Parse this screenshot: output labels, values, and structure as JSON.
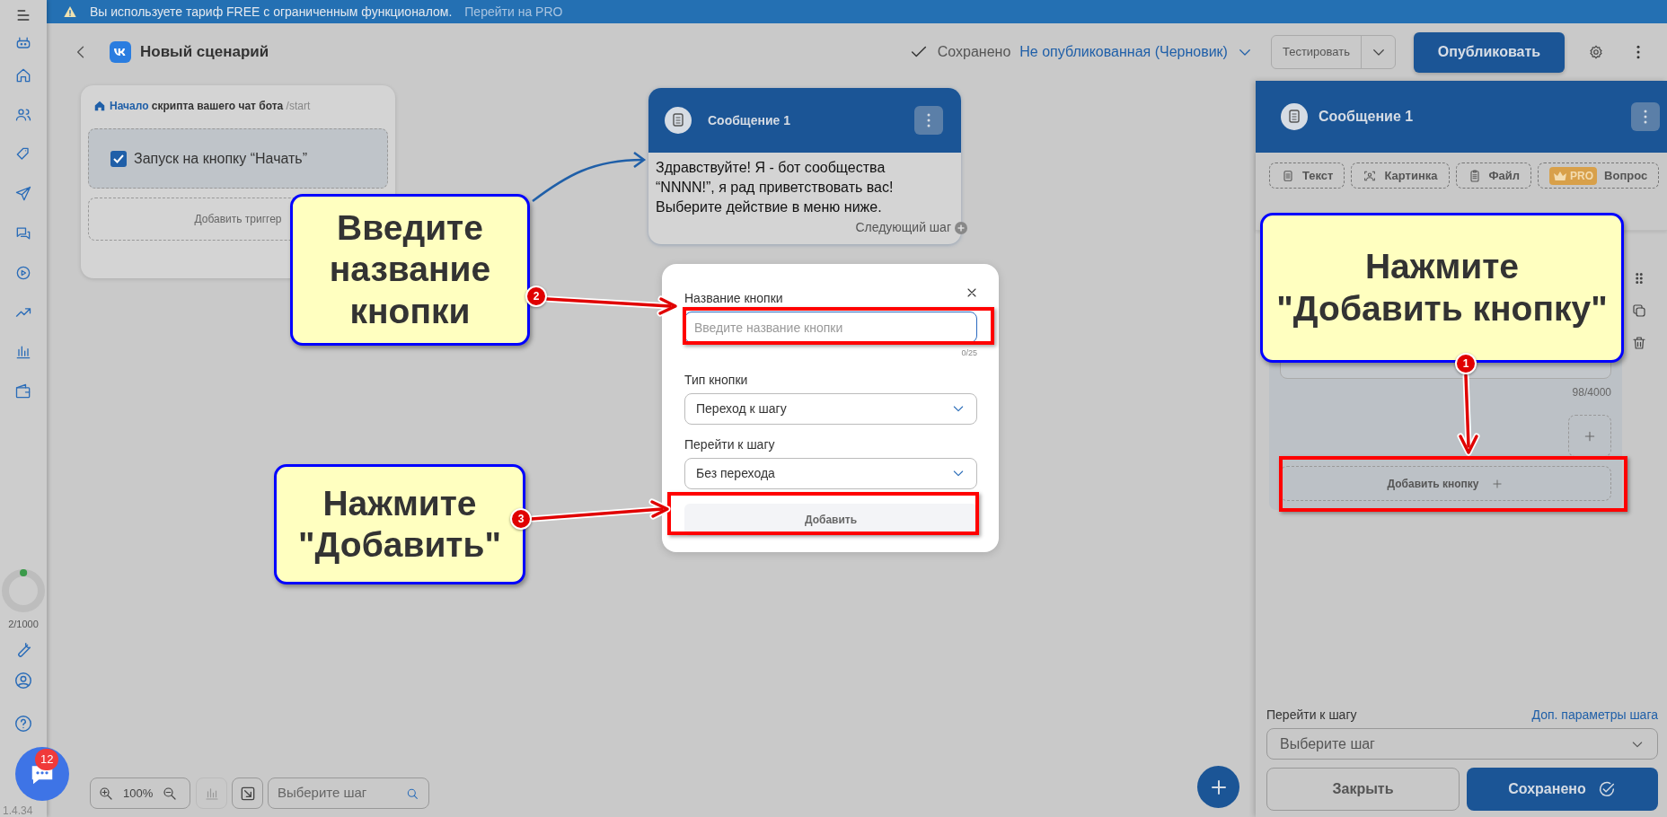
{
  "banner": {
    "text": "Вы используете тариф FREE с ограниченным функционалом.",
    "link": "Перейти на PRO"
  },
  "sidebar": {
    "usage": {
      "text": "2/1000"
    },
    "chat_badge": "12",
    "version": "1.4.34"
  },
  "header": {
    "title": "Новый сценарий",
    "save_status": "Сохранено",
    "publish_state": "Не опубликованная (Черновик)",
    "test_button": "Тестировать",
    "publish_button": "Опубликовать"
  },
  "start_node": {
    "link": "Начало",
    "text": "скрипта вашего чат бота",
    "command": "/start",
    "triggers": [
      {
        "label": "Запуск на кнопку “Начать”",
        "checked": true
      }
    ],
    "add_trigger": "Добавить триггер"
  },
  "message_node": {
    "title": "Сообщение 1",
    "text": "Здравствуйте! Я - бот сообщества “NNNN!”, я рад приветствовать вас! Выберите действие в меню ниже.",
    "next_step": "Следующий шаг"
  },
  "modal": {
    "fields": [
      {
        "kind": "input",
        "label": "Название кнопки",
        "placeholder": "Введите название кнопки",
        "counter": "0/25",
        "focused": true
      },
      {
        "kind": "select",
        "label": "Тип кнопки",
        "value": "Переход к шагу"
      },
      {
        "kind": "select",
        "label": "Перейти к шагу",
        "value": "Без перехода"
      }
    ],
    "submit": "Добавить"
  },
  "canvas_toolbar": {
    "zoom": "100%",
    "search_placeholder": "Выберите шаг"
  },
  "panel": {
    "title": "Сообщение 1",
    "tools": [
      {
        "kind": "text",
        "label": "Текст"
      },
      {
        "kind": "image",
        "label": "Картинка"
      },
      {
        "kind": "file",
        "label": "Файл"
      },
      {
        "kind": "question",
        "label": "Вопрос",
        "badge": "PRO"
      }
    ],
    "char_count": "98/4000",
    "add_button": "Добавить кнопку",
    "next_step_label": "Перейти к шагу",
    "params_link": "Доп. параметры шага",
    "step_placeholder": "Выберите шаг",
    "close_button": "Закрыть",
    "save_button": "Сохранено"
  },
  "annotations": [
    {
      "number": "2",
      "text": "Введите название кнопки"
    },
    {
      "number": "1",
      "text": "Нажмите \"Добавить кнопку\""
    },
    {
      "number": "3",
      "text": "Нажмите \"Добавить\""
    }
  ]
}
